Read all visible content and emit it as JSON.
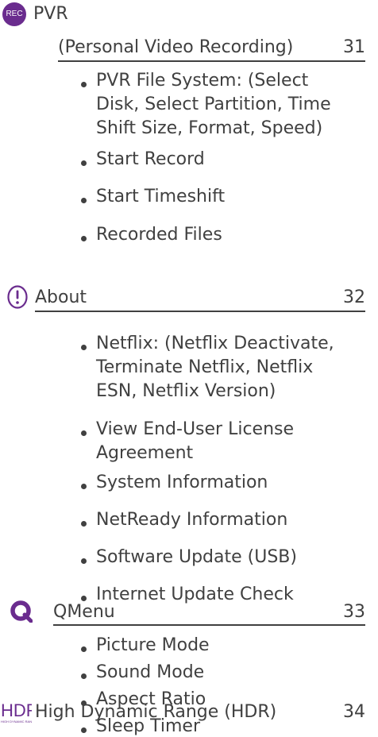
{
  "colors": {
    "text": "#404040",
    "accent": "#6a2c8e"
  },
  "icons": {
    "rec": "rec-badge-icon",
    "about": "exclamation-icon",
    "qmenu": "q-icon",
    "hdr": "hdr-logo-icon"
  },
  "pvr": {
    "rec_badge": "REC",
    "title": "PVR",
    "subtitle": "(Personal Video Recording)",
    "page": "31",
    "items": [
      [
        "PVR File System: (Select",
        "Disk, Select Partition, Time",
        "Shift Size, Format, Speed)"
      ],
      [
        "Start Record"
      ],
      [
        "Start Timeshift"
      ],
      [
        "Recorded Files"
      ]
    ]
  },
  "about": {
    "title": "About",
    "page": "32",
    "items": [
      [
        "Netflix: (Netflix Deactivate,",
        "Terminate Netflix, Netflix",
        "ESN, Netflix Version)"
      ],
      [
        "View End-User License",
        "Agreement"
      ],
      [
        "System Information"
      ],
      [
        "NetReady Information"
      ],
      [
        "Software Update (USB)"
      ],
      [
        "Internet Update Check"
      ]
    ]
  },
  "qmenu": {
    "title": "QMenu",
    "page": "33",
    "items": [
      [
        "Picture Mode"
      ],
      [
        "Sound Mode"
      ],
      [
        "Aspect Ratio"
      ],
      [
        "Sleep Timer"
      ]
    ]
  },
  "hdr": {
    "logo_text": "HDR",
    "logo_subtext": "HIGH DYNAMIC RANGE",
    "title": "High Dynamic Range (HDR)",
    "page": "34"
  }
}
